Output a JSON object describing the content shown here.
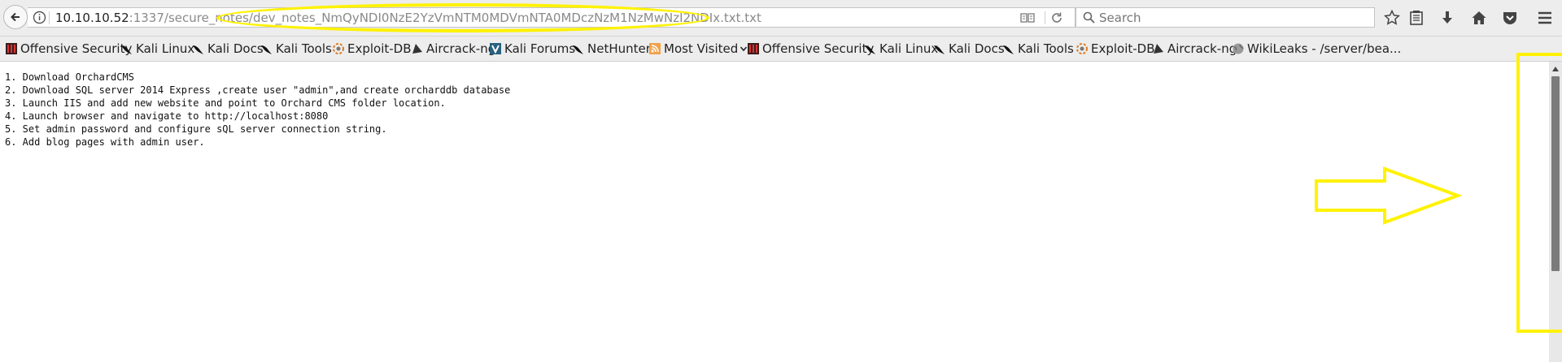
{
  "browser": {
    "url_host": "10.10.10.52",
    "url_rest": ":1337/secure_notes/dev_notes_NmQyNDI0NzE2YzVmNTM0MDVmNTA0MDczNzM1NzMwNzI2NDIx.txt.txt",
    "search_placeholder": "Search"
  },
  "bookmarks": [
    {
      "label": "Offensive Security",
      "icon": "offsec-icon"
    },
    {
      "label": "Kali Linux",
      "icon": "kali-dragon-icon"
    },
    {
      "label": "Kali Docs",
      "icon": "kali-dragon-icon"
    },
    {
      "label": "Kali Tools",
      "icon": "kali-dragon-icon"
    },
    {
      "label": "Exploit-DB",
      "icon": "exploit-db-icon"
    },
    {
      "label": "Aircrack-ng",
      "icon": "aircrack-icon"
    },
    {
      "label": "Kali Forums",
      "icon": "kali-forums-icon"
    },
    {
      "label": "NetHunter",
      "icon": "kali-dragon-icon"
    },
    {
      "label": "Most Visited",
      "icon": "rss-icon"
    },
    {
      "label": "Offensive Security",
      "icon": "offsec-icon"
    },
    {
      "label": "Kali Linux",
      "icon": "kali-dragon-icon"
    },
    {
      "label": "Kali Docs",
      "icon": "kali-dragon-icon"
    },
    {
      "label": "Kali Tools",
      "icon": "kali-dragon-icon"
    },
    {
      "label": "Exploit-DB",
      "icon": "exploit-db-icon"
    },
    {
      "label": "Aircrack-ng",
      "icon": "aircrack-icon"
    },
    {
      "label": "WikiLeaks - /server/bea...",
      "icon": "globe-icon"
    }
  ],
  "document": {
    "lines": [
      "1. Download OrchardCMS",
      "2. Download SQL server 2014 Express ,create user \"admin\",and create orcharddb database",
      "3. Launch IIS and add new website and point to Orchard CMS folder location.",
      "4. Launch browser and navigate to http://localhost:8080",
      "5. Set admin password and configure sQL server connection string.",
      "6. Add blog pages with admin user."
    ]
  },
  "colors": {
    "highlight": "#fff200",
    "chrome": "#ededed"
  }
}
